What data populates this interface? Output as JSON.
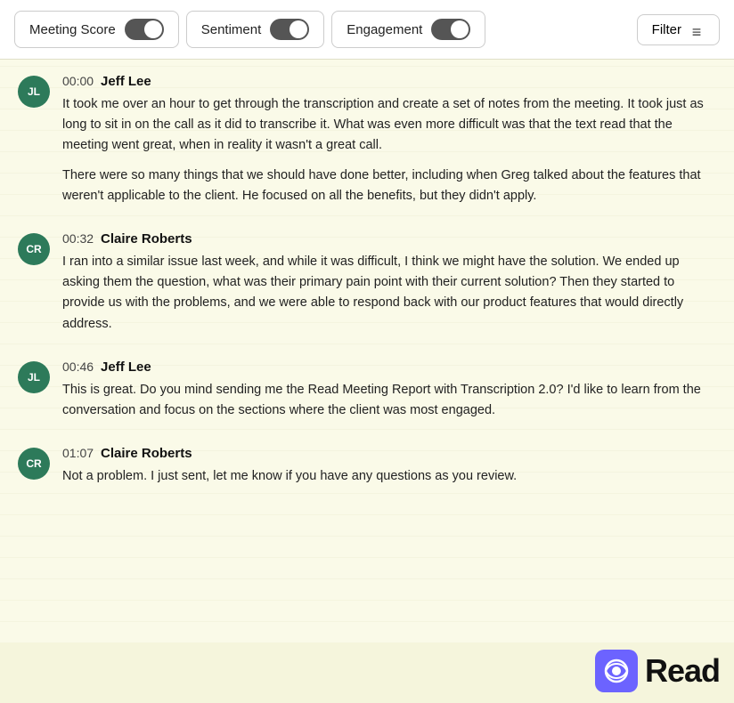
{
  "toolbar": {
    "meeting_score_label": "Meeting Score",
    "sentiment_label": "Sentiment",
    "engagement_label": "Engagement",
    "filter_label": "Filter"
  },
  "messages": [
    {
      "id": 1,
      "initials": "JL",
      "speaker": "Jeff Lee",
      "timestamp": "00:00",
      "paragraphs": [
        "It took me over an hour to get through the transcription and create a set of notes from the meeting. It took just as long to sit in on the call as it did to transcribe it. What was even more difficult was that the text read that the meeting went great, when in reality it wasn't a great call.",
        "There were so many things that we should have done better, including when Greg talked about the features that weren't applicable to the client. He focused on all the benefits, but they didn't apply."
      ]
    },
    {
      "id": 2,
      "initials": "CR",
      "speaker": "Claire Roberts",
      "timestamp": "00:32",
      "paragraphs": [
        "I ran into a similar issue last week, and while it was difficult, I think we might have the solution. We ended up asking them the question, what was their primary pain point with their current solution? Then they started to provide us with the problems, and we were able to respond back with our product features that would directly address."
      ]
    },
    {
      "id": 3,
      "initials": "JL",
      "speaker": "Jeff Lee",
      "timestamp": "00:46",
      "paragraphs": [
        "This is great. Do you mind sending me the Read Meeting Report with Transcription 2.0? I'd like to learn from the conversation and focus on the sections where the client was most engaged."
      ]
    },
    {
      "id": 4,
      "initials": "CR",
      "speaker": "Claire Roberts",
      "timestamp": "01:07",
      "paragraphs": [
        "Not a problem. I just sent, let me know if you have any questions as you review."
      ]
    }
  ],
  "branding": {
    "logo_text": "Read",
    "logo_icon_symbol": "◎"
  }
}
